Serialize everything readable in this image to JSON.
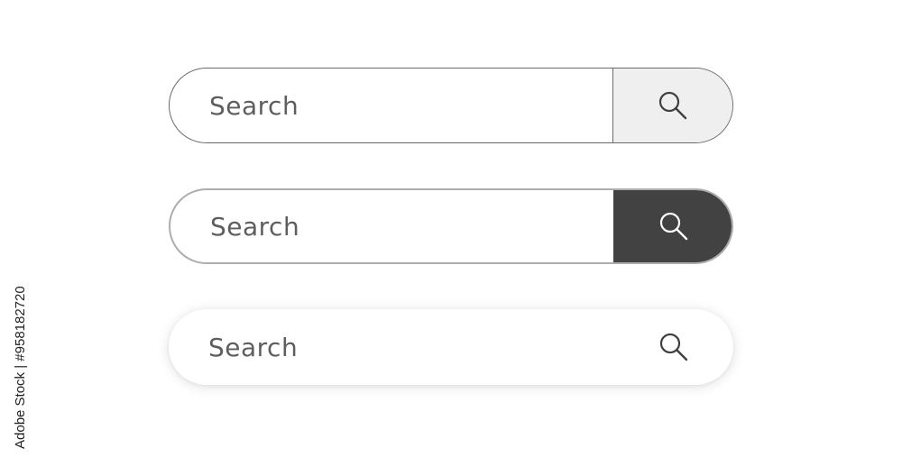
{
  "search_bars": [
    {
      "style": "outlined-light-button",
      "placeholder": "Search",
      "icon": "search-icon",
      "button_color": "#efefef",
      "icon_color": "#3f3f3f"
    },
    {
      "style": "outlined-dark-button",
      "placeholder": "Search",
      "icon": "search-icon",
      "button_color": "#424242",
      "icon_color": "#ffffff"
    },
    {
      "style": "shadow-plain",
      "placeholder": "Search",
      "icon": "search-icon",
      "button_color": "transparent",
      "icon_color": "#3f3f3f"
    }
  ],
  "watermark": {
    "text": "Adobe Stock | #958182720"
  }
}
